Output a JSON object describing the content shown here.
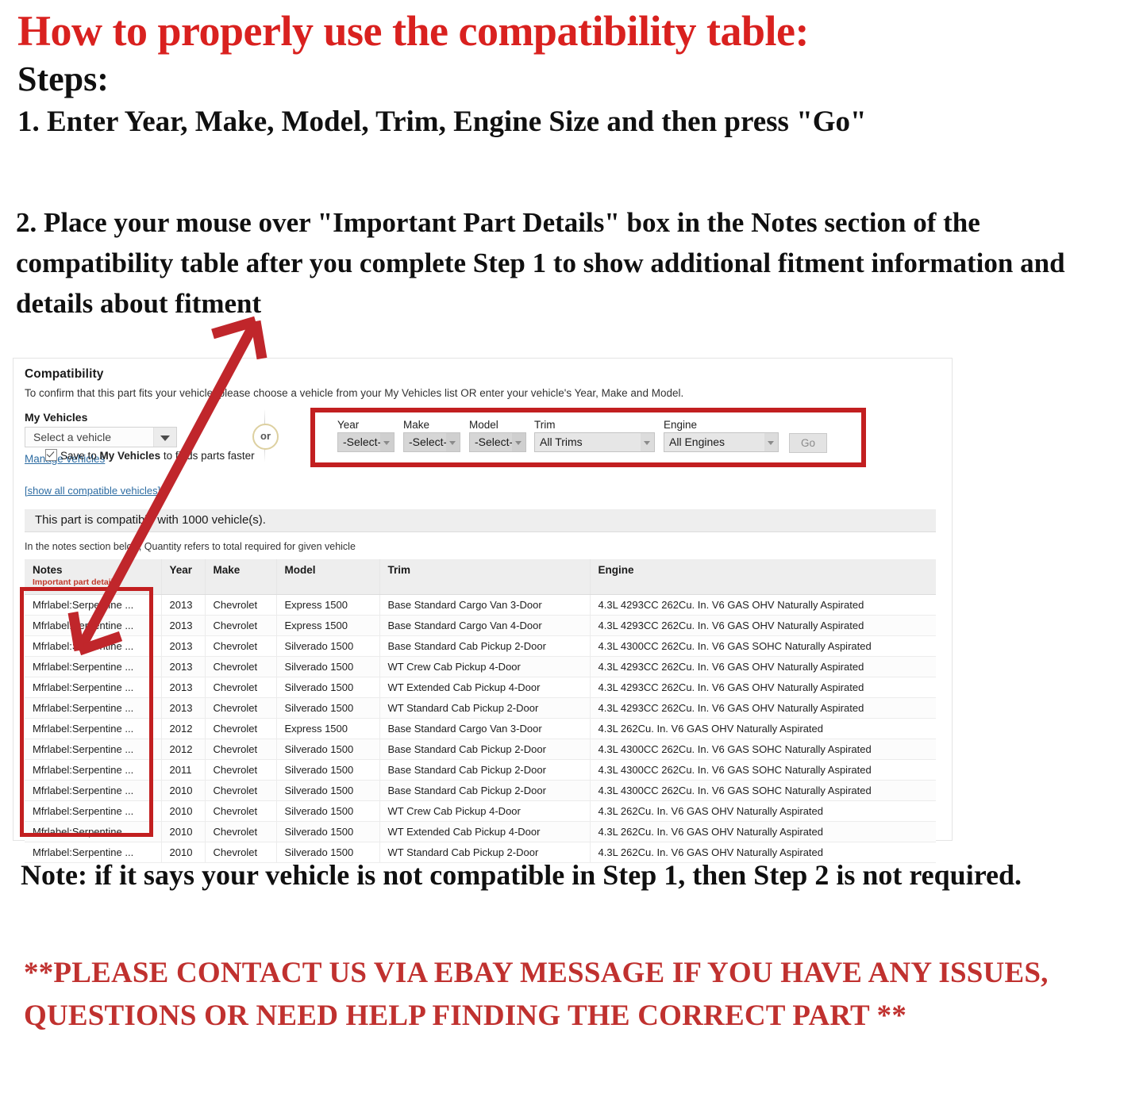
{
  "headings": {
    "title": "How to properly use the compatibility table:",
    "steps_label": "Steps:",
    "step_one": "1. Enter Year, Make, Model, Trim, Engine Size and then press \"Go\"",
    "step_two": "2. Place your mouse over \"Important Part Details\" box in the Notes section of the compatibility table after you complete Step 1 to show additional fitment information and details about fitment",
    "note": "Note: if it says your vehicle is not compatible in Step 1, then Step 2 is not required.",
    "contact": "**PLEASE CONTACT US VIA EBAY MESSAGE IF YOU HAVE ANY ISSUES, QUESTIONS OR NEED HELP FINDING THE CORRECT PART **"
  },
  "compatibility": {
    "title": "Compatibility",
    "subtitle": "To confirm that this part fits your vehicle, please choose a vehicle from your My Vehicles list OR enter your vehicle's Year, Make and Model.",
    "my_vehicles_label": "My Vehicles",
    "my_vehicles_value": "Select a vehicle",
    "manage_vehicles_link": "Manage vehicles",
    "show_all_link": "[show all compatible vehicles]",
    "or_divider": "or",
    "count_message": "This part is compatible with 1000 vehicle(s).",
    "notes_hint": "In the notes section below, Quantity refers to total required for given vehicle",
    "selectors": [
      {
        "label": "Year",
        "value": "-Select-"
      },
      {
        "label": "Make",
        "value": "-Select-"
      },
      {
        "label": "Model",
        "value": "-Select-"
      },
      {
        "label": "Trim",
        "value": "All Trims"
      },
      {
        "label": "Engine",
        "value": "All Engines"
      }
    ],
    "go_button": "Go",
    "save_checkbox": {
      "prefix": "Save to ",
      "bold": "My Vehicles",
      "suffix": " to finds parts faster",
      "checked": true
    },
    "accent_red": "#c21f20",
    "link_blue": "#2d6ca2"
  },
  "table": {
    "columns": [
      {
        "label": "Notes",
        "sub": "Important part details"
      },
      {
        "label": "Year",
        "sub": ""
      },
      {
        "label": "Make",
        "sub": ""
      },
      {
        "label": "Model",
        "sub": ""
      },
      {
        "label": "Trim",
        "sub": ""
      },
      {
        "label": "Engine",
        "sub": ""
      }
    ],
    "rows": [
      [
        "Mfrlabel:Serpentine ...",
        "2013",
        "Chevrolet",
        "Express 1500",
        "Base Standard Cargo Van 3-Door",
        "4.3L 4293CC 262Cu. In. V6 GAS OHV Naturally Aspirated"
      ],
      [
        "Mfrlabel:Serpentine ...",
        "2013",
        "Chevrolet",
        "Express 1500",
        "Base Standard Cargo Van 4-Door",
        "4.3L 4293CC 262Cu. In. V6 GAS OHV Naturally Aspirated"
      ],
      [
        "Mfrlabel:Serpentine ...",
        "2013",
        "Chevrolet",
        "Silverado 1500",
        "Base Standard Cab Pickup 2-Door",
        "4.3L 4300CC 262Cu. In. V6 GAS SOHC Naturally Aspirated"
      ],
      [
        "Mfrlabel:Serpentine ...",
        "2013",
        "Chevrolet",
        "Silverado 1500",
        "WT Crew Cab Pickup 4-Door",
        "4.3L 4293CC 262Cu. In. V6 GAS OHV Naturally Aspirated"
      ],
      [
        "Mfrlabel:Serpentine ...",
        "2013",
        "Chevrolet",
        "Silverado 1500",
        "WT Extended Cab Pickup 4-Door",
        "4.3L 4293CC 262Cu. In. V6 GAS OHV Naturally Aspirated"
      ],
      [
        "Mfrlabel:Serpentine ...",
        "2013",
        "Chevrolet",
        "Silverado 1500",
        "WT Standard Cab Pickup 2-Door",
        "4.3L 4293CC 262Cu. In. V6 GAS OHV Naturally Aspirated"
      ],
      [
        "Mfrlabel:Serpentine ...",
        "2012",
        "Chevrolet",
        "Express 1500",
        "Base Standard Cargo Van 3-Door",
        "4.3L 262Cu. In. V6 GAS OHV Naturally Aspirated"
      ],
      [
        "Mfrlabel:Serpentine ...",
        "2012",
        "Chevrolet",
        "Silverado 1500",
        "Base Standard Cab Pickup 2-Door",
        "4.3L 4300CC 262Cu. In. V6 GAS SOHC Naturally Aspirated"
      ],
      [
        "Mfrlabel:Serpentine ...",
        "2011",
        "Chevrolet",
        "Silverado 1500",
        "Base Standard Cab Pickup 2-Door",
        "4.3L 4300CC 262Cu. In. V6 GAS SOHC Naturally Aspirated"
      ],
      [
        "Mfrlabel:Serpentine ...",
        "2010",
        "Chevrolet",
        "Silverado 1500",
        "Base Standard Cab Pickup 2-Door",
        "4.3L 4300CC 262Cu. In. V6 GAS SOHC Naturally Aspirated"
      ],
      [
        "Mfrlabel:Serpentine ...",
        "2010",
        "Chevrolet",
        "Silverado 1500",
        "WT Crew Cab Pickup 4-Door",
        "4.3L 262Cu. In. V6 GAS OHV Naturally Aspirated"
      ],
      [
        "Mfrlabel:Serpentine ...",
        "2010",
        "Chevrolet",
        "Silverado 1500",
        "WT Extended Cab Pickup 4-Door",
        "4.3L 262Cu. In. V6 GAS OHV Naturally Aspirated"
      ],
      [
        "Mfrlabel:Serpentine ...",
        "2010",
        "Chevrolet",
        "Silverado 1500",
        "WT Standard Cab Pickup 2-Door",
        "4.3L 262Cu. In. V6 GAS OHV Naturally Aspirated"
      ]
    ]
  }
}
